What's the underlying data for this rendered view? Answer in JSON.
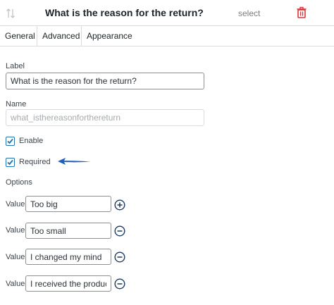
{
  "header": {
    "title": "What is the reason for the return?",
    "type": "select"
  },
  "tabs": [
    {
      "label": "General"
    },
    {
      "label": "Advanced"
    },
    {
      "label": "Appearance"
    }
  ],
  "label_field": {
    "label": "Label",
    "value": "What is the reason for the return?"
  },
  "name_field": {
    "label": "Name",
    "value": "what_isthereasonforthereturn"
  },
  "enable": {
    "label": "Enable",
    "checked": true
  },
  "required": {
    "label": "Required",
    "checked": true
  },
  "options": {
    "heading": "Options",
    "items": [
      {
        "label": "Value",
        "value": "Too big",
        "action": "add"
      },
      {
        "label": "Value",
        "value": "Too small",
        "action": "remove"
      },
      {
        "label": "Value",
        "value": "I changed my mind",
        "action": "remove"
      },
      {
        "label": "Value",
        "value": "I received the product",
        "action": "remove"
      }
    ]
  },
  "colors": {
    "accent": "#2271b1",
    "delete": "#d63638",
    "arrow": "#1f5fbf"
  }
}
